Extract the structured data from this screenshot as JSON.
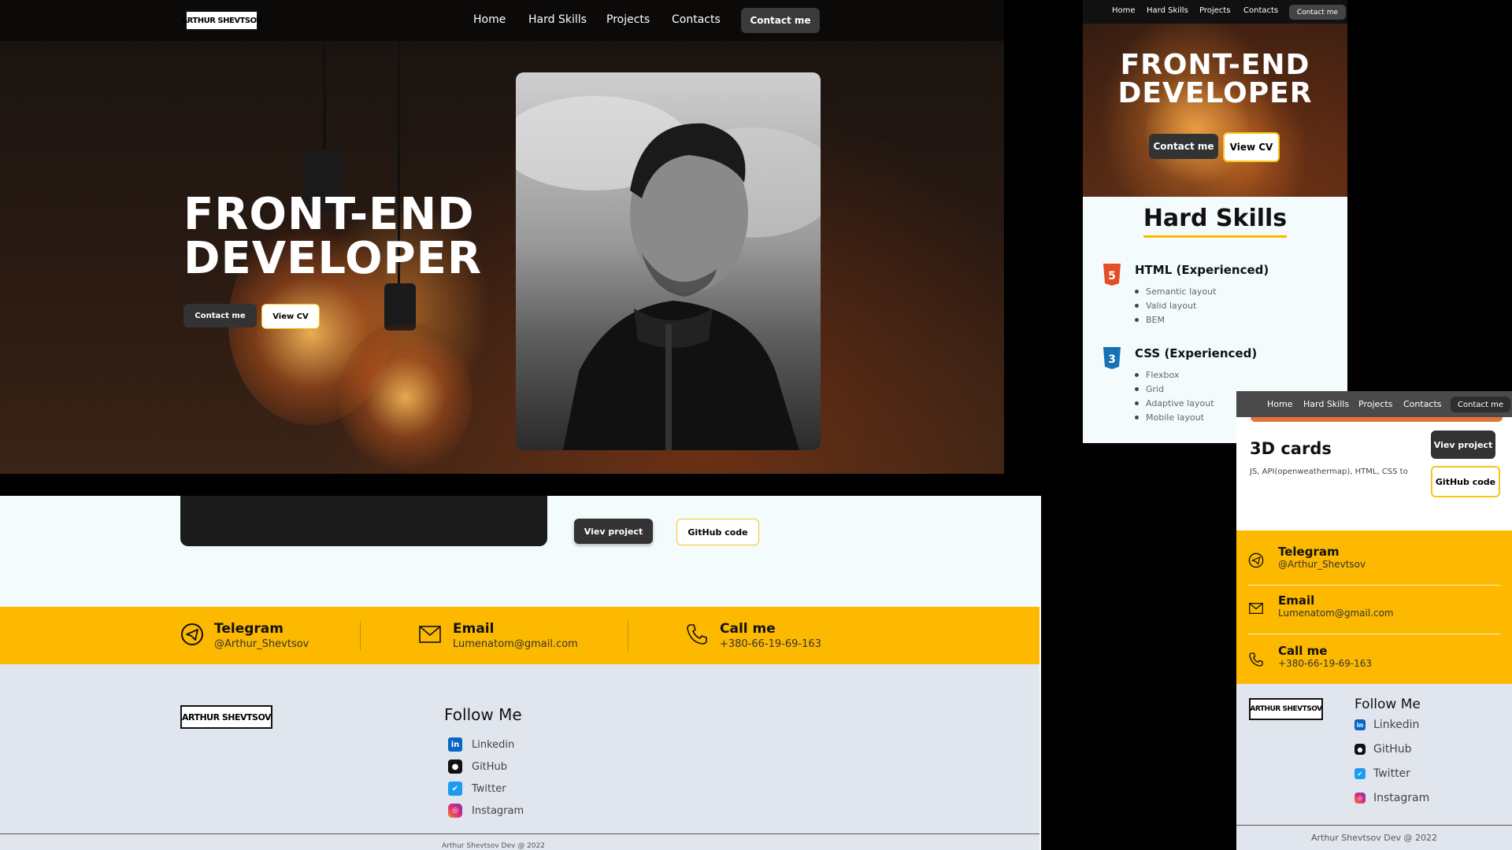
{
  "brand": {
    "logo_text": "ARTHUR SHEVTSOV"
  },
  "nav": {
    "items": [
      "Home",
      "Hard Skills",
      "Projects",
      "Contacts"
    ],
    "cta": "Contact me"
  },
  "hero": {
    "title_line1": "FRONT-END",
    "title_line2": "DEVELOPER",
    "contact_button": "Contact me",
    "cv_button": "View CV"
  },
  "projects": {
    "view_project_button": "Viev project",
    "github_button": "GitHub code",
    "card_title": "3D cards",
    "card_desc": "JS, API(openweathermap), HTML, CSS to"
  },
  "contacts": [
    {
      "icon": "telegram-icon",
      "title": "Telegram",
      "value": "@Arthur_Shevtsov"
    },
    {
      "icon": "email-icon",
      "title": "Email",
      "value": "Lumenatom@gmail.com"
    },
    {
      "icon": "phone-icon",
      "title": "Call me",
      "value": "+380-66-19-69-163"
    }
  ],
  "hard_skills": {
    "heading": "Hard Skills",
    "groups": [
      {
        "icon": "html5-icon",
        "title": "HTML (Experienced)",
        "items": [
          "Semantic layout",
          "Valid layout",
          "BEM"
        ]
      },
      {
        "icon": "css3-icon",
        "title": "CSS (Experienced)",
        "items": [
          "Flexbox",
          "Grid",
          "Adaptive layout",
          "Mobile layout"
        ]
      }
    ]
  },
  "footer": {
    "follow_title": "Follow Me",
    "links": [
      {
        "icon": "linkedin-icon",
        "label": "Linkedin"
      },
      {
        "icon": "github-icon",
        "label": "GitHub"
      },
      {
        "icon": "twitter-icon",
        "label": "Twitter"
      },
      {
        "icon": "instagram-icon",
        "label": "Instagram"
      }
    ],
    "copyright": "Arthur Shevtsov Dev @ 2022"
  },
  "colors": {
    "accent_yellow": "#fcb900",
    "nav_bg": "#0c0a09",
    "footer_bg": "#e1e6ee",
    "html_orange": "#e44d26",
    "css_blue": "#1572b6",
    "linkedin_blue": "#0a66c2",
    "twitter_blue": "#1d9bf0"
  }
}
